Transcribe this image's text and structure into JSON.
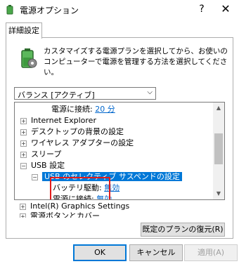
{
  "window": {
    "title": "電源オプション",
    "help_glyph": "?",
    "close_glyph": "✕"
  },
  "tabs": [
    {
      "label": "詳細設定"
    }
  ],
  "description": "カスタマイズする電源プランを選択してから、お使いのコンピューターで電源を管理する方法を選択してください。",
  "plan_select": {
    "selected": "バランス [アクティブ]"
  },
  "tree": {
    "items": [
      {
        "label": "電源に接続:",
        "value": "20 分"
      },
      {
        "label": "Internet Explorer"
      },
      {
        "label": "デスクトップの背景の設定"
      },
      {
        "label": "ワイヤレス アダプターの設定"
      },
      {
        "label": "スリープ"
      },
      {
        "label": "USB 設定"
      },
      {
        "label": "USB のセレクティブ サスペンドの設定"
      },
      {
        "label": "バッテリ駆動:",
        "value": "無効"
      },
      {
        "label": "電源に接続:",
        "value": "無効"
      },
      {
        "label": "Intel(R) Graphics Settings"
      },
      {
        "label": "電源ボタンとカバー"
      }
    ]
  },
  "buttons": {
    "restore": "既定のプランの復元(R)",
    "ok": "OK",
    "cancel": "キャンセル",
    "apply": "適用(A)"
  },
  "colors": {
    "selection": "#0078d7",
    "highlight_box": "#e21b1b",
    "link": "#0066cc"
  }
}
